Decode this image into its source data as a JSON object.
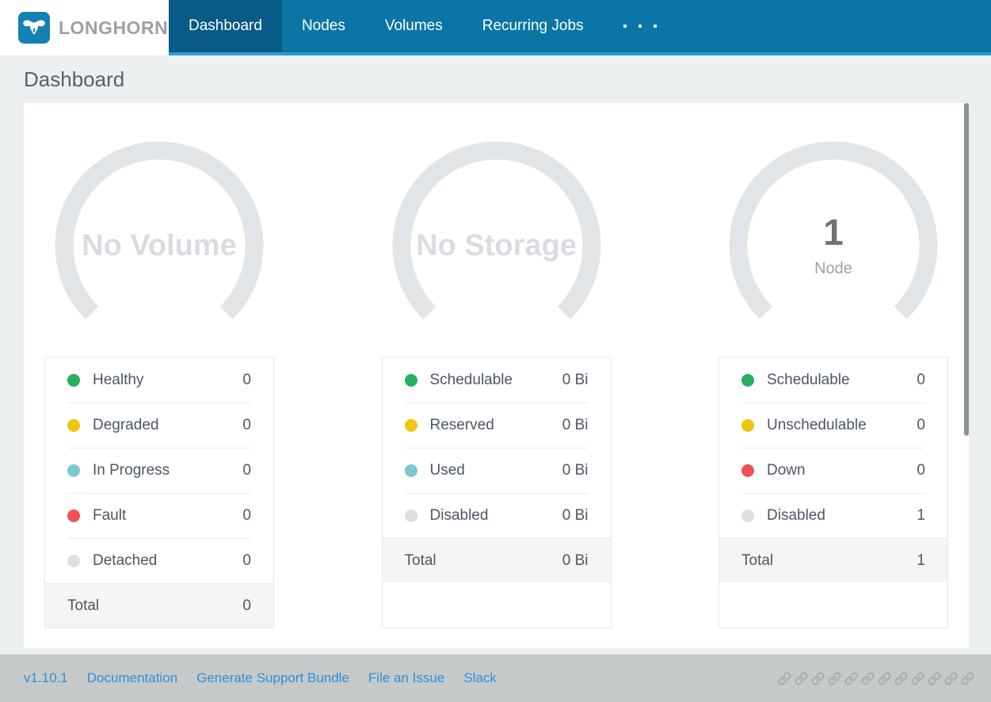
{
  "header": {
    "brand": "LONGHORN",
    "nav_items": [
      {
        "label": "Dashboard",
        "active": true
      },
      {
        "label": "Nodes",
        "active": false
      },
      {
        "label": "Volumes",
        "active": false
      },
      {
        "label": "Recurring Jobs",
        "active": false
      }
    ],
    "more_menu_dots": 3
  },
  "page": {
    "title": "Dashboard"
  },
  "gauges": [
    {
      "name": "volume-gauge",
      "center_label": "No Volume"
    },
    {
      "name": "storage-gauge",
      "center_label": "No Storage"
    },
    {
      "name": "node-gauge",
      "value": "1",
      "unit": "Node"
    }
  ],
  "panels": [
    {
      "name": "volume-summary",
      "rows": [
        {
          "label": "Healthy",
          "value": "0",
          "color": "#27ae5f"
        },
        {
          "label": "Degraded",
          "value": "0",
          "color": "#f0c40f"
        },
        {
          "label": "In Progress",
          "value": "0",
          "color": "#7dc9d0"
        },
        {
          "label": "Fault",
          "value": "0",
          "color": "#f05152"
        },
        {
          "label": "Detached",
          "value": "0",
          "color": "#dedfe0"
        }
      ],
      "total_label": "Total",
      "total_value": "0"
    },
    {
      "name": "storage-summary",
      "rows": [
        {
          "label": "Schedulable",
          "value": "0 Bi",
          "color": "#27ae5f"
        },
        {
          "label": "Reserved",
          "value": "0 Bi",
          "color": "#f0c40f"
        },
        {
          "label": "Used",
          "value": "0 Bi",
          "color": "#7dc9d0"
        },
        {
          "label": "Disabled",
          "value": "0 Bi",
          "color": "#dedfe0"
        }
      ],
      "total_label": "Total",
      "total_value": "0 Bi"
    },
    {
      "name": "node-summary",
      "rows": [
        {
          "label": "Schedulable",
          "value": "0",
          "color": "#27ae5f"
        },
        {
          "label": "Unschedulable",
          "value": "0",
          "color": "#f0c40f"
        },
        {
          "label": "Down",
          "value": "0",
          "color": "#f05152"
        },
        {
          "label": "Disabled",
          "value": "1",
          "color": "#dedfe0"
        }
      ],
      "total_label": "Total",
      "total_value": "1"
    }
  ],
  "footer": {
    "version": "v1.10.1",
    "links": [
      {
        "label": "Documentation"
      },
      {
        "label": "Generate Support Bundle"
      },
      {
        "label": "File an Issue"
      },
      {
        "label": "Slack"
      }
    ],
    "link_icon_count": 12
  },
  "icons": {
    "logo": "longhorn-bull-icon",
    "nav_more": "ellipsis-menu-icon",
    "footer_repeat": "link-icon"
  },
  "colors": {
    "nav_bg": "#0b76a6",
    "nav_active_bg": "#0a5a87",
    "nav_underline": "#2f9dcc",
    "link_blue": "#2e90d8",
    "gauge_arc": "#e2e5e8",
    "logo_blue": "#1580b2"
  }
}
